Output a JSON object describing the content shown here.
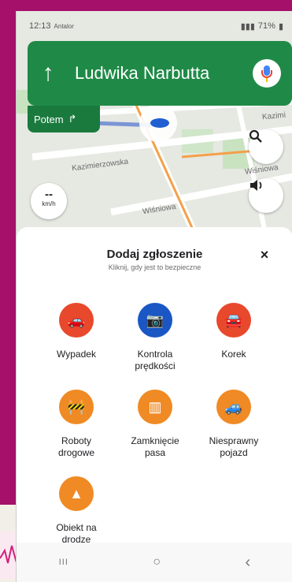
{
  "status": {
    "time": "12:13",
    "carrier": "Antalor",
    "battery": "71%"
  },
  "nav": {
    "street": "Ludwika Narbutta",
    "then_label": "Potem"
  },
  "map": {
    "street_labels": [
      "Kazimierzowska",
      "Wiśniowa",
      "Wiśniowa",
      "Kazimi"
    ],
    "speed_value": "--",
    "speed_unit": "km/h"
  },
  "sheet": {
    "title": "Dodaj zgłoszenie",
    "subtitle": "Kliknij, gdy jest to bezpieczne",
    "close_glyph": "×",
    "items": [
      {
        "label_lines": [
          "Wypadek"
        ],
        "color": "#e8492c",
        "icon": "crash-icon"
      },
      {
        "label_lines": [
          "Kontrola",
          "prędkości"
        ],
        "color": "#1a57c4",
        "icon": "speed-camera-icon"
      },
      {
        "label_lines": [
          "Korek"
        ],
        "color": "#e8492c",
        "icon": "traffic-jam-icon"
      },
      {
        "label_lines": [
          "Roboty",
          "drogowe"
        ],
        "color": "#f08a24",
        "icon": "roadworks-icon"
      },
      {
        "label_lines": [
          "Zamknięcie",
          "pasa"
        ],
        "color": "#f08a24",
        "icon": "lane-closure-icon"
      },
      {
        "label_lines": [
          "Niesprawny",
          "pojazd"
        ],
        "color": "#f08a24",
        "icon": "stalled-vehicle-icon"
      },
      {
        "label_lines": [
          "Obiekt na",
          "drodze"
        ],
        "color": "#f08a24",
        "icon": "road-object-icon"
      }
    ]
  },
  "navbar": {
    "recents": "III",
    "home": "○",
    "back": "‹"
  }
}
